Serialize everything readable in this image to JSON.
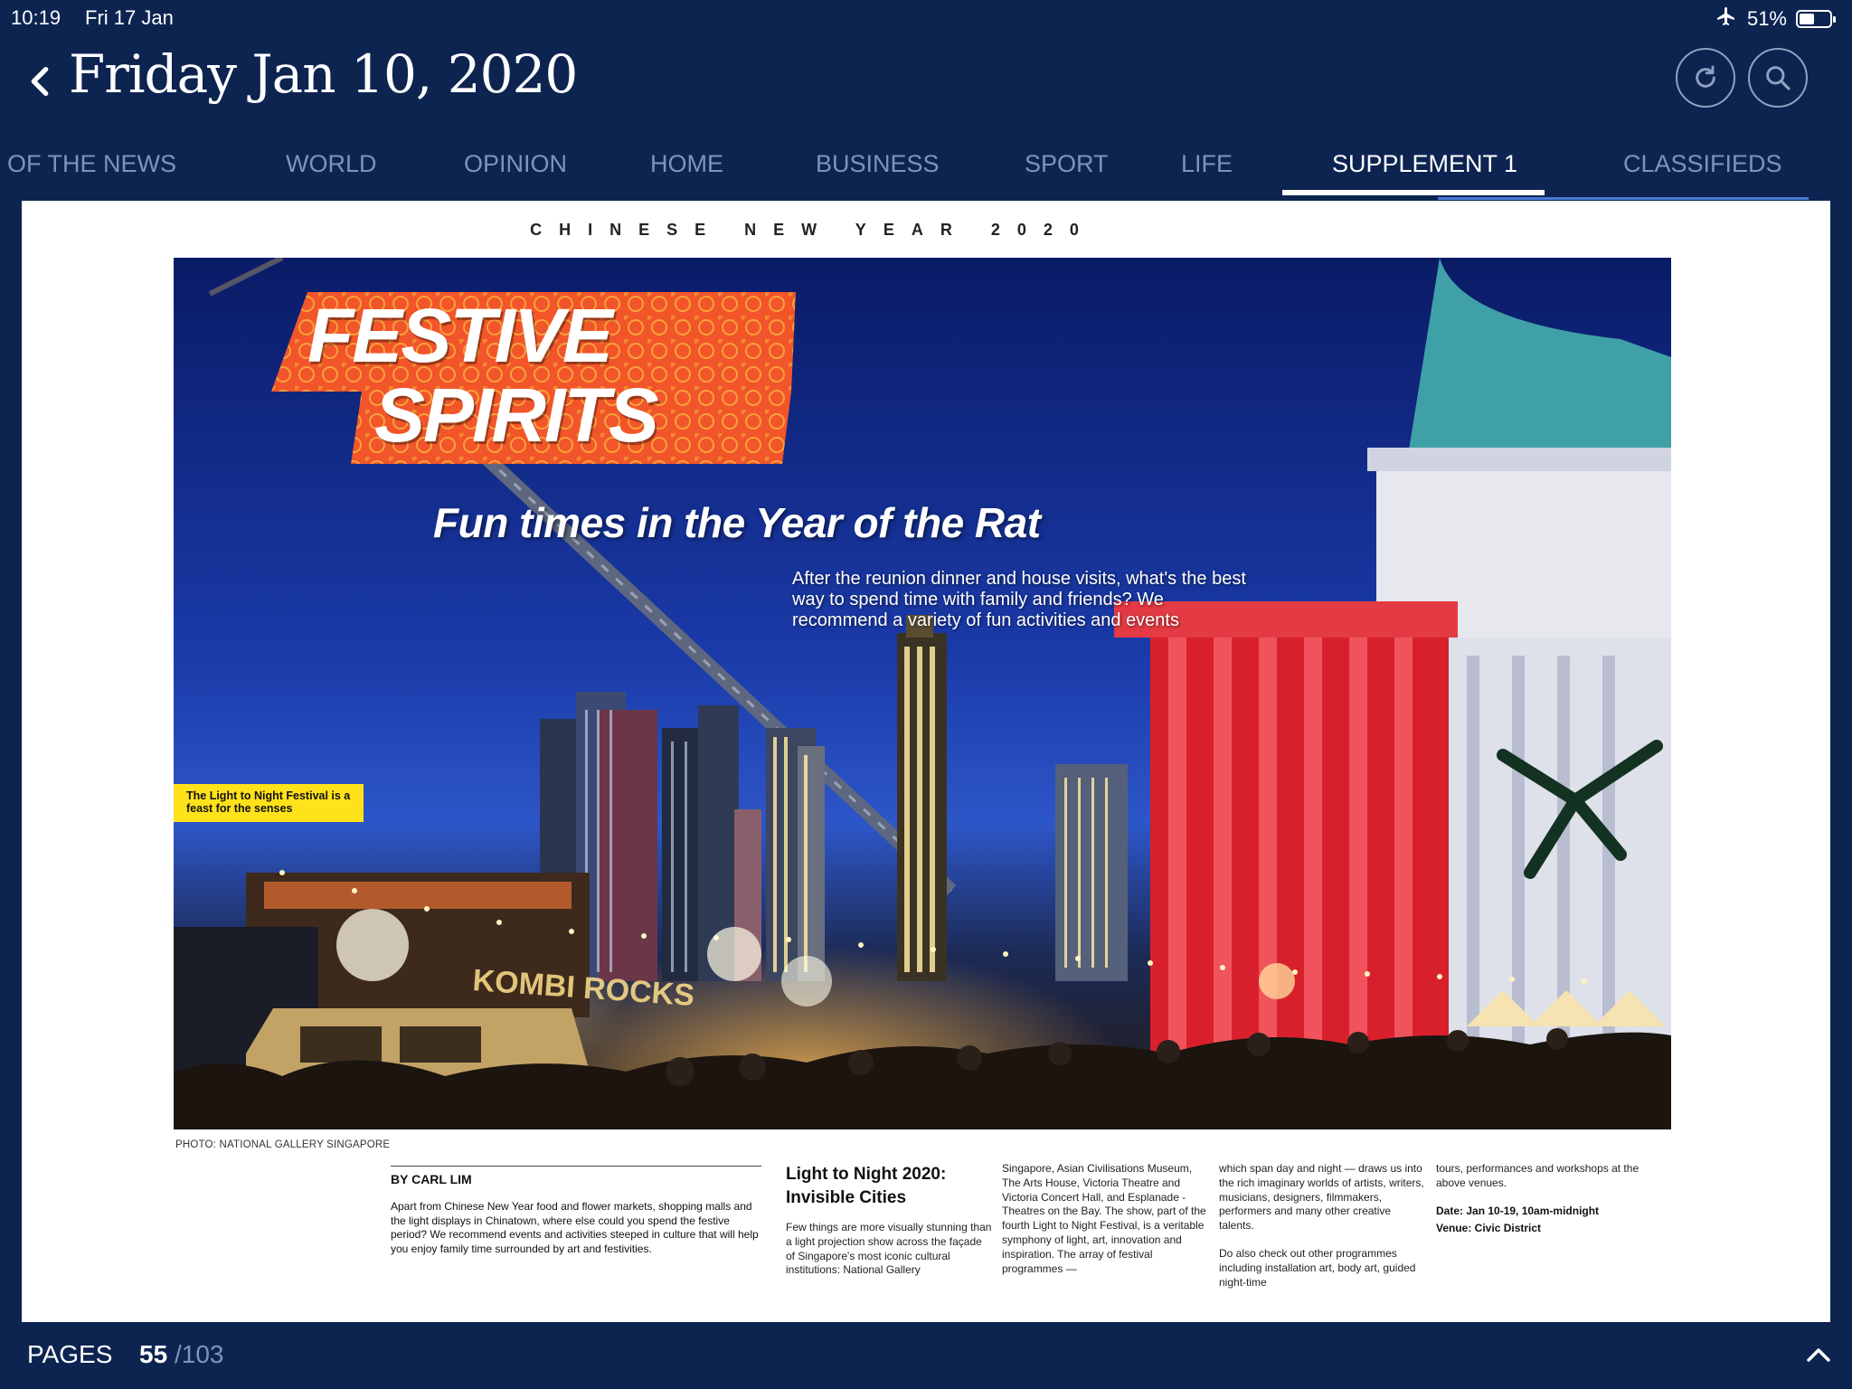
{
  "status_bar": {
    "time": "10:19",
    "date": "Fri 17 Jan",
    "battery": "51%",
    "battery_level": 0.51
  },
  "header": {
    "title": "Friday Jan 10, 2020"
  },
  "tabs": [
    {
      "label": "OF THE NEWS",
      "active": false
    },
    {
      "label": "WORLD",
      "active": false
    },
    {
      "label": "OPINION",
      "active": false
    },
    {
      "label": "HOME",
      "active": false
    },
    {
      "label": "BUSINESS",
      "active": false
    },
    {
      "label": "SPORT",
      "active": false
    },
    {
      "label": "LIFE",
      "active": false
    },
    {
      "label": "SUPPLEMENT 1",
      "active": true
    },
    {
      "label": "CLASSIFIEDS",
      "active": false
    }
  ],
  "article": {
    "supertitle": "CHINESE NEW YEAR 2020",
    "banner_line1": "FESTIVE",
    "banner_line2": "SPIRITS",
    "subhead": "Fun times in the Year of the Rat",
    "intro": "After the reunion dinner and house visits, what's the best way to spend time with family and friends? We recommend a variety of fun activities and events",
    "photo_caption": "The Light to Night Festival is a feast for the senses",
    "photo_signage": "KOMBI ROCKS",
    "photo_credit": "PHOTO: NATIONAL GALLERY SINGAPORE",
    "byline": "BY CARL LIM",
    "lede": "Apart from Chinese New Year food and flower markets, shopping malls and the light displays in Chinatown, where else could you spend the festive period? We recommend events and activities steeped in culture that will help you enjoy family time surrounded by art and festivities.",
    "section_heading": "Light to Night 2020: Invisible Cities",
    "col1": "Few things are more visually stunning than a light projection show across the façade of Singapore's most iconic cultural institutions: National Gallery",
    "col2": "Singapore, Asian Civilisations Museum, The Arts House, Victoria Theatre and Victoria Concert Hall, and Esplanade - Theatres on the Bay. The show, part of the fourth Light to Night Festival, is a veritable symphony of light, art, innovation and inspiration. The array of festival programmes —",
    "col3_p1": "which span day and night — draws us into the rich imaginary worlds of artists, writers, musicians, designers, filmmakers, performers and many other creative talents.",
    "col3_p2": "Do also check out other programmes including installation art, body art, guided night-time",
    "col4_p1": "tours, performances and workshops at the above venues.",
    "date_info": "Date: Jan 10-19, 10am-midnight",
    "venue_info": "Venue: Civic District"
  },
  "footer": {
    "pages_label": "PAGES",
    "current_page": "55",
    "total_pages": "/103"
  },
  "colors": {
    "nav_bg": "#0d2451",
    "tab_inactive": "#7f93ba",
    "banner_orange": "#f2552a",
    "caption_yellow": "#ffe21a"
  }
}
